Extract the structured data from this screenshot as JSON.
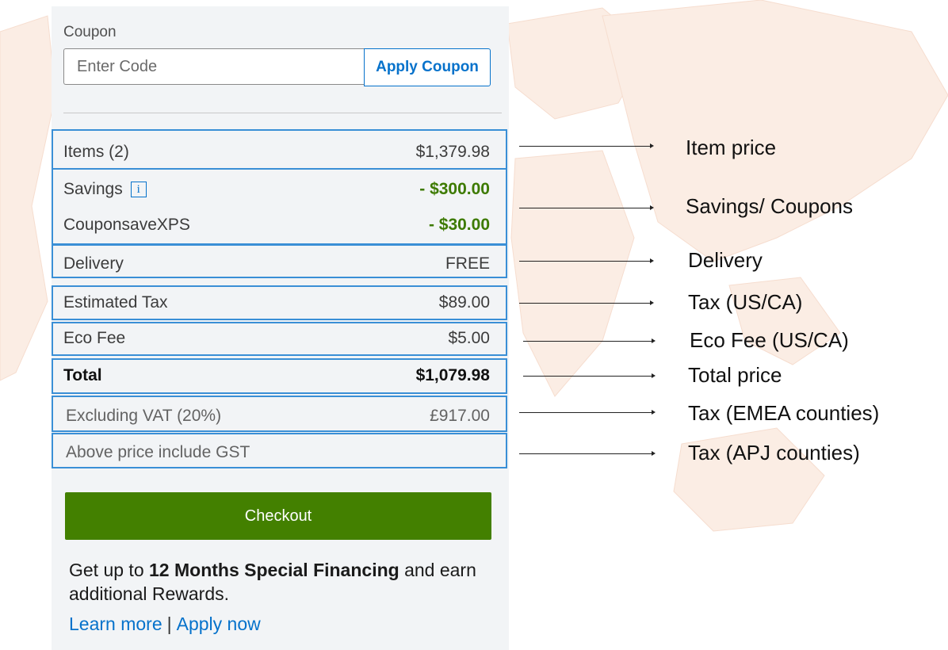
{
  "coupon": {
    "label": "Coupon",
    "placeholder": "Enter Code",
    "apply_label": "Apply Coupon"
  },
  "summary": {
    "items_label": "Items (2)",
    "items_value": "$1,379.98",
    "savings_label": "Savings",
    "savings_info_glyph": "i",
    "savings_value": "- $300.00",
    "coupon_label": "CouponsaveXPS",
    "coupon_value": "- $30.00",
    "delivery_label": "Delivery",
    "delivery_value": "FREE",
    "tax_label": "Estimated Tax",
    "tax_value": "$89.00",
    "eco_label": "Eco Fee",
    "eco_value": "$5.00",
    "total_label": "Total",
    "total_value": "$1,079.98",
    "vat_label": "Excluding VAT (20%)",
    "vat_value": "£917.00",
    "gst_label": "Above price include GST"
  },
  "checkout": {
    "label": "Checkout"
  },
  "financing": {
    "prefix": "Get up to ",
    "highlight": "12 Months Special Financing",
    "suffix": " and earn additional Rewards.",
    "learn_more": "Learn more",
    "apply_now": "Apply now"
  },
  "annotations": [
    "Item price",
    "Savings/ Coupons",
    "Delivery",
    "Tax (US/CA)",
    "Eco Fee (US/CA)",
    "Total price",
    "Tax (EMEA counties)",
    "Tax (APJ counties)"
  ],
  "colors": {
    "accent_blue": "#0672cb",
    "savings_green": "#3d7a00",
    "checkout_green": "#438000",
    "panel_bg": "#f2f4f6",
    "map_tint": "#fbeee6"
  }
}
